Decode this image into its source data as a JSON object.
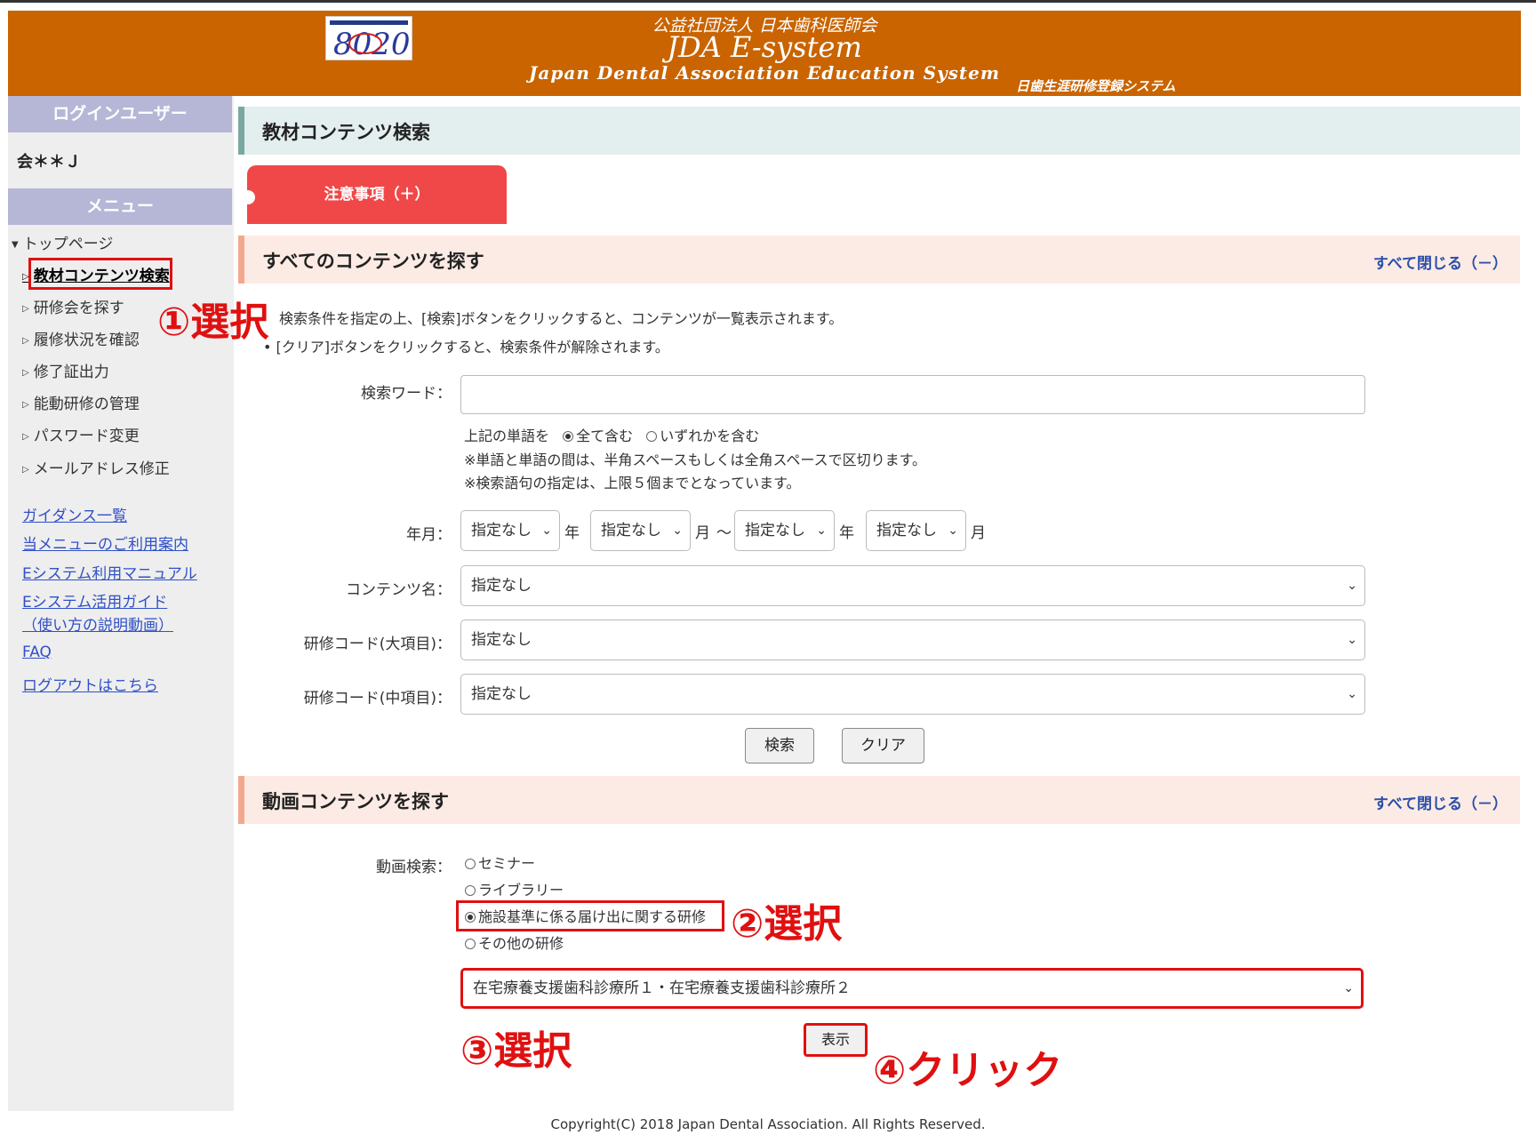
{
  "header": {
    "org": "公益社団法人 日本歯科医師会",
    "title": "JDA E-system",
    "subtitle": "Japan Dental Association Education System",
    "right_text": "日歯生涯研修登録システム",
    "logo_text": "8020"
  },
  "sidebar": {
    "login_user_heading": "ログインユーザー",
    "user_name": "会＊＊Ｊ",
    "menu_heading": "メニュー",
    "top_page": "トップページ",
    "items": [
      {
        "label": "教材コンテンツ検索"
      },
      {
        "label": "研修会を探す"
      },
      {
        "label": "履修状況を確認"
      },
      {
        "label": "修了証出力"
      },
      {
        "label": "能動研修の管理"
      },
      {
        "label": "パスワード変更"
      },
      {
        "label": "メールアドレス修正"
      }
    ],
    "links": [
      {
        "label": "ガイダンス一覧"
      },
      {
        "label": "当メニューのご利用案内"
      },
      {
        "label": "Eシステム利用マニュアル"
      },
      {
        "label": "Eシステム活用ガイド"
      },
      {
        "label": "（使い方の説明動画）"
      },
      {
        "label": "FAQ"
      },
      {
        "label": "ログアウトはこちら"
      }
    ]
  },
  "main": {
    "page_title": "教材コンテンツ検索",
    "notice_tab": "注意事項（＋）",
    "search_section": {
      "title": "すべてのコンテンツを探す",
      "close_all": "すべて閉じる（－）",
      "note1": "検索条件を指定の上、[検索]ボタンをクリックすると、コンテンツが一覧表示されます。",
      "note2": "[クリア]ボタンをクリックすると、検索条件が解除されます。",
      "keyword_label": "検索ワード：",
      "keyword_value": "",
      "word_mode_label": "上記の単語を",
      "word_mode_all": "全て含む",
      "word_mode_any": "いずれかを含む",
      "hint1": "※単語と単語の間は、半角スペースもしくは全角スペースで区切ります。",
      "hint2": "※検索語句の指定は、上限５個までとなっています。",
      "date_label": "年月：",
      "year_from": "指定なし",
      "month_from": "指定なし",
      "year_to": "指定なし",
      "month_to": "指定なし",
      "unit_year": "年",
      "unit_month": "月",
      "tilde": "～",
      "content_name_label": "コンテンツ名：",
      "content_name_value": "指定なし",
      "code_major_label": "研修コード(大項目)：",
      "code_major_value": "指定なし",
      "code_mid_label": "研修コード(中項目)：",
      "code_mid_value": "指定なし",
      "search_button": "検索",
      "clear_button": "クリア"
    },
    "video_section": {
      "title": "動画コンテンツを探す",
      "close_all": "すべて閉じる（－）",
      "label": "動画検索：",
      "options": [
        "セミナー",
        "ライブラリー",
        "施設基準に係る届け出に関する研修",
        "その他の研修"
      ],
      "selected_option": "施設基準に係る届け出に関する研修",
      "select_value": "在宅療養支援歯科診療所１・在宅療養支援歯科診療所２",
      "show_button": "表示"
    }
  },
  "annotations": {
    "step1": "①選択",
    "step2": "②選択",
    "step3": "③選択",
    "step4": "④クリック",
    "color": "#e01010"
  },
  "footer": {
    "copyright": "Copyright(C) 2018 Japan Dental Association. All Rights Reserved."
  },
  "colors": {
    "header_bg": "#c96400",
    "sidebar_heading_bg": "#b6b6d6",
    "notice_tab_bg": "#f04848",
    "section_bg": "#fcebe5",
    "link": "#3050c8"
  }
}
